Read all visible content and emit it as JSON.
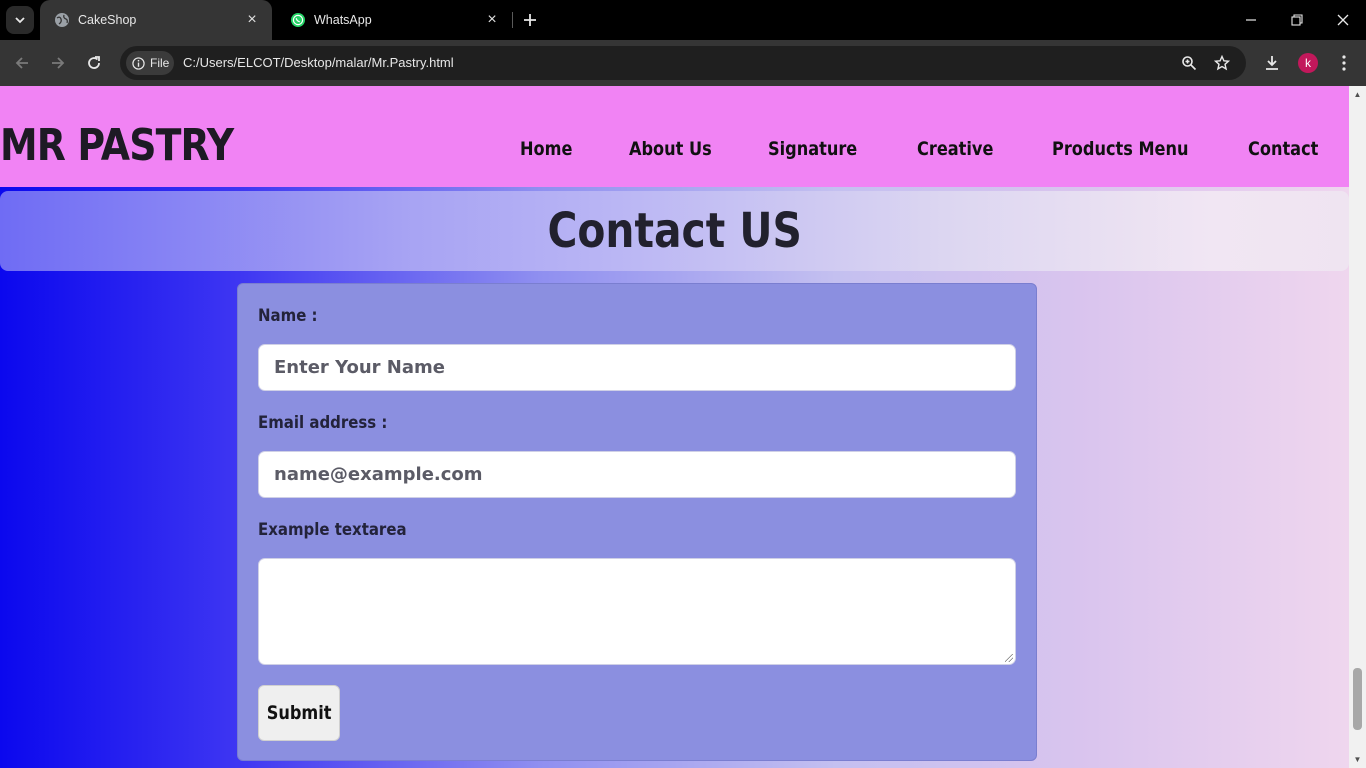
{
  "browser": {
    "tabs": [
      {
        "title": "CakeShop",
        "icon": "globe-icon",
        "active": true
      },
      {
        "title": "WhatsApp",
        "icon": "whatsapp-icon",
        "active": false
      }
    ],
    "site_chip_label": "File",
    "url": "C:/Users/ELCOT/Desktop/malar/Mr.Pastry.html",
    "profile_initial": "k",
    "colors": {
      "tabstrip": "#000000",
      "toolbar": "#353535",
      "profile": "#c2185b",
      "whatsapp": "#25d366"
    }
  },
  "site": {
    "brand": "MR PASTRY",
    "nav": [
      "Home",
      "About Us",
      "Signature",
      "Creative",
      "Products Menu",
      "Contact"
    ],
    "header_color": "#f183f4"
  },
  "contact": {
    "title": "Contact US",
    "form": {
      "name_label": "Name :",
      "name_placeholder": "Enter Your Name",
      "email_label": "Email address :",
      "email_placeholder": "name@example.com",
      "textarea_label": "Example textarea",
      "submit_label": "Submit"
    },
    "card_color": "#8b8fe0"
  }
}
